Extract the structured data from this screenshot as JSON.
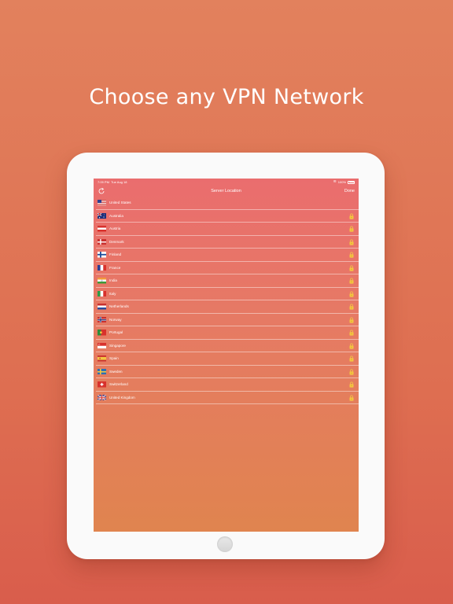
{
  "headline": "Choose any VPN Network",
  "status_bar": {
    "time": "7:09 PM",
    "date": "Tue Aug 18",
    "battery": "100%"
  },
  "nav": {
    "title": "Server Location",
    "done_label": "Done"
  },
  "servers": [
    {
      "name": "United States",
      "flag": "us",
      "locked": false
    },
    {
      "name": "Australia",
      "flag": "au",
      "locked": true
    },
    {
      "name": "Austria",
      "flag": "at",
      "locked": true
    },
    {
      "name": "Denmark",
      "flag": "dk",
      "locked": true
    },
    {
      "name": "Finland",
      "flag": "fi",
      "locked": true
    },
    {
      "name": "France",
      "flag": "fr",
      "locked": true
    },
    {
      "name": "India",
      "flag": "in",
      "locked": true
    },
    {
      "name": "Italy",
      "flag": "it",
      "locked": true
    },
    {
      "name": "Netherlands",
      "flag": "nl",
      "locked": true
    },
    {
      "name": "Norway",
      "flag": "no",
      "locked": true
    },
    {
      "name": "Portugal",
      "flag": "pt",
      "locked": true
    },
    {
      "name": "Singapore",
      "flag": "sg",
      "locked": true
    },
    {
      "name": "Spain",
      "flag": "es",
      "locked": true
    },
    {
      "name": "Sweden",
      "flag": "se",
      "locked": true
    },
    {
      "name": "Switzerland",
      "flag": "ch",
      "locked": true
    },
    {
      "name": "United Kingdom",
      "flag": "gb",
      "locked": true
    }
  ],
  "colors": {
    "background_top": "#e2815d",
    "background_bottom": "#d95d4c",
    "screen_top": "#ea6d6e",
    "screen_bottom": "#e0844f",
    "lock": "#f4c542"
  }
}
